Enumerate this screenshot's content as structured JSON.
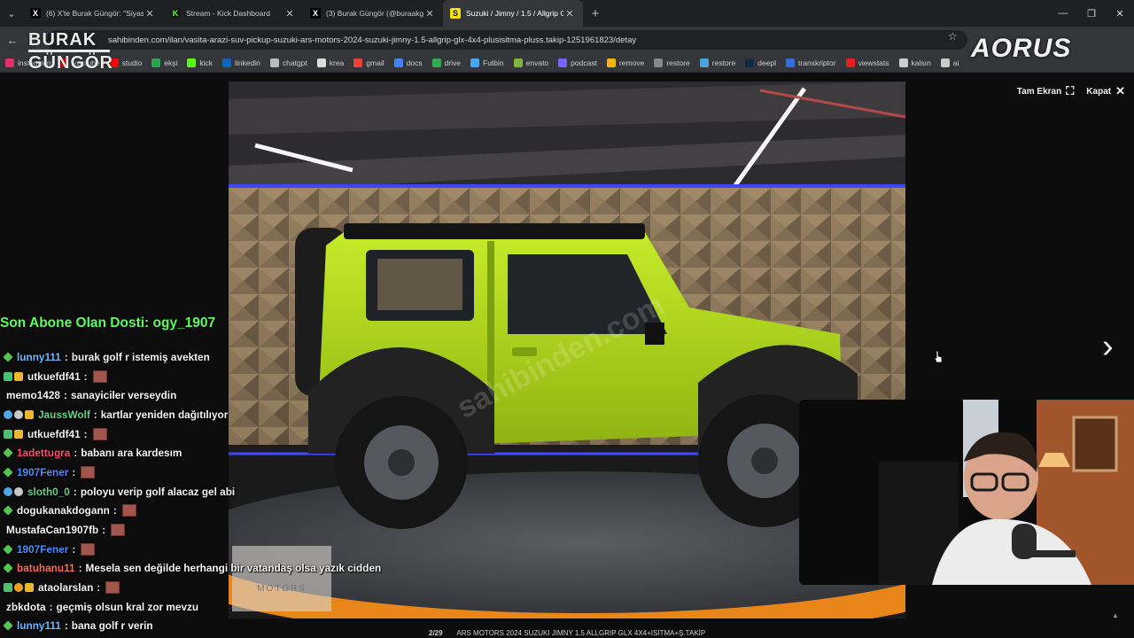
{
  "browser": {
    "tabs": [
      {
        "title": "(6) X'te Burak Güngör: \"Siyasi k",
        "favicon": "X",
        "active": false
      },
      {
        "title": "Stream - Kick Dashboard",
        "favicon": "K",
        "active": false
      },
      {
        "title": "(3) Burak Güngör (@buraakgun",
        "favicon": "X",
        "active": false
      },
      {
        "title": "Suzuki / Jimny / 1.5 / Allgrip GL",
        "favicon": "S",
        "active": true
      }
    ],
    "url": "sahibinden.com/ilan/vasita-arazi-suv-pickup-suzuki-ars-motors-2024-suzuki-jimny-1.5-allgrip-glx-4x4-plusisitma-pluss.takip-1251961823/detay",
    "bookmarks": [
      "instagram",
      "youtube",
      "studio",
      "ekşi",
      "kick",
      "linkedin",
      "chatgpt",
      "krea",
      "gmail",
      "docs",
      "drive",
      "Futbin",
      "envato",
      "podcast",
      "remove",
      "restore",
      "restore",
      "deepl",
      "transkriptor",
      "viewstats",
      "kalsın",
      "ai"
    ]
  },
  "overlay": {
    "logo_left": [
      "BURAK",
      "GÜNGÖR"
    ],
    "logo_right": "AORUS",
    "subscriber_banner": "Son Abone Olan Dosti: ogy_1907"
  },
  "viewer": {
    "fullscreen_label": "Tam Ekran",
    "close_label": "Kapat",
    "counter": "2/29",
    "caption": "ARS MOTORS 2024 SUZUKI JIMNY 1.5 ALLGRIP GLX 4X4+ISITMA+Ş.TAKİP",
    "watermark": "sahibinden.com"
  },
  "chat": {
    "messages": [
      {
        "user": "lunny111",
        "color": "#66b8ff",
        "badges": [
          "green"
        ],
        "text": "burak golf r istemiş avekten",
        "emote": false
      },
      {
        "user": "utkuefdf41",
        "color": "#f2f2f2",
        "badges": [
          "shield",
          "gold"
        ],
        "text": "",
        "emote": true
      },
      {
        "user": "memo1428",
        "color": "#f2f2f2",
        "badges": [],
        "text": "sanayiciler verseydin",
        "emote": false
      },
      {
        "user": "JaussWolf",
        "color": "#5fd18a",
        "badges": [
          "blue",
          "grey",
          "gold"
        ],
        "text": "kartlar yeniden dağıtılıyor",
        "emote": false
      },
      {
        "user": "utkuefdf41",
        "color": "#f2f2f2",
        "badges": [
          "shield",
          "gold"
        ],
        "text": "",
        "emote": true
      },
      {
        "user": "1adettugra",
        "color": "#ff4d6a",
        "badges": [
          "green"
        ],
        "text": "babanı ara kardesım",
        "emote": false
      },
      {
        "user": "1907Fener",
        "color": "#4d8bff",
        "badges": [
          "green"
        ],
        "text": "",
        "emote": true
      },
      {
        "user": "sloth0_0",
        "color": "#5fd18a",
        "badges": [
          "blue",
          "grey"
        ],
        "text": "poloyu verip golf alacaz gel abi",
        "emote": false
      },
      {
        "user": "dogukanakdogann",
        "color": "#f2f2f2",
        "badges": [
          "green"
        ],
        "text": "",
        "emote": true
      },
      {
        "user": "MustafaCan1907fb",
        "color": "#f2f2f2",
        "badges": [],
        "text": "",
        "emote": true
      },
      {
        "user": "1907Fener",
        "color": "#4d8bff",
        "badges": [
          "green"
        ],
        "text": "",
        "emote": true
      },
      {
        "user": "batuhanu11",
        "color": "#ff6a5a",
        "badges": [
          "green"
        ],
        "text": "Mesela sen değilde herhangi bir vatandaş olsa yazık cidden",
        "emote": false
      },
      {
        "user": "ataolarslan",
        "color": "#f2f2f2",
        "badges": [
          "shield",
          "orange",
          "gold"
        ],
        "text": "",
        "emote": true
      },
      {
        "user": "zbkdota",
        "color": "#f2f2f2",
        "badges": [],
        "text": "geçmiş olsun kral zor mevzu",
        "emote": false
      },
      {
        "user": "lunny111",
        "color": "#66b8ff",
        "badges": [
          "green"
        ],
        "text": "bana golf r verin",
        "emote": false
      }
    ]
  },
  "colors": {
    "jimny": "#b6e01e",
    "subscriber_banner": "#5cff5c",
    "turntable": "#e8861a"
  }
}
